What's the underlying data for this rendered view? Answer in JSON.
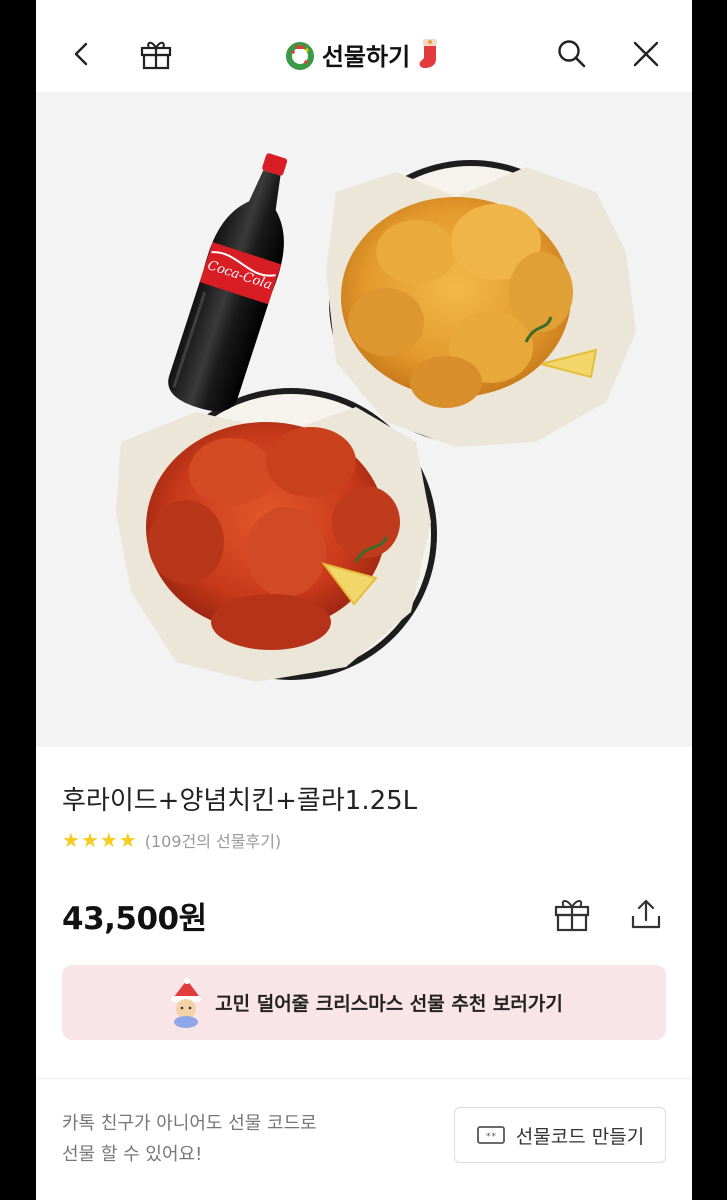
{
  "header": {
    "title": "선물하기",
    "back_icon": "chevron-left-icon",
    "gift_icon": "gift-icon",
    "search_icon": "search-icon",
    "close_icon": "close-icon"
  },
  "product": {
    "name": "후라이드+양념치킨+콜라1.25L",
    "rating": 4,
    "review_count": "(109건의 선물후기)",
    "price": "43,500원",
    "image_items": [
      "Coca-Cola"
    ]
  },
  "banner": {
    "text": "고민 덜어줄 크리스마스 선물 추천 보러가기"
  },
  "footer": {
    "line1": "카톡 친구가 아니어도 선물 코드로",
    "line2": "선물 할 수 있어요!",
    "code_button": "선물코드 만들기"
  },
  "colors": {
    "star": "#f6cc1f",
    "banner_bg": "#f9e4e7",
    "hero_bg": "#f3f3f3"
  }
}
